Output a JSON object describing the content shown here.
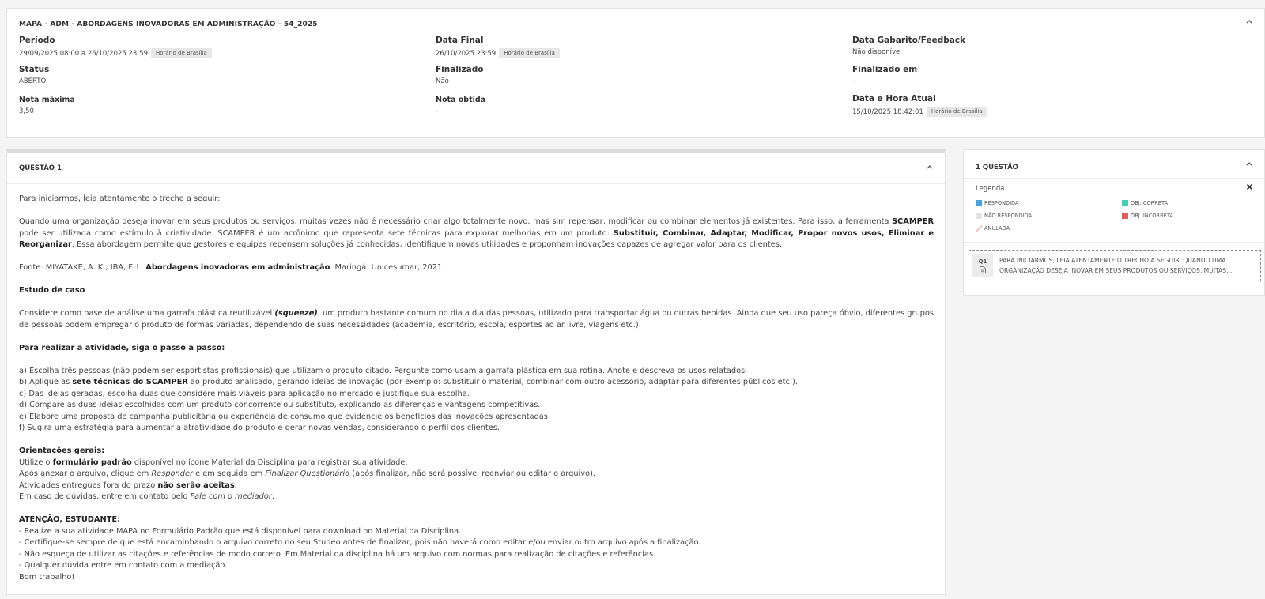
{
  "header": {
    "title": "MAPA - ADM - ABORDAGENS INOVADORAS EM ADMINISTRAÇÃO - 54_2025",
    "fields": {
      "periodo_label": "Período",
      "periodo_value": "29/09/2025 08:00 a 26/10/2025 23:59",
      "periodo_badge": "Horário de Brasília",
      "data_final_label": "Data Final",
      "data_final_value": "26/10/2025 23:59",
      "data_final_badge": "Horário de Brasília",
      "gabarito_label": "Data Gabarito/Feedback",
      "gabarito_value": "Não disponível",
      "status_label": "Status",
      "status_value": "ABERTO",
      "finalizado_label": "Finalizado",
      "finalizado_value": "Não",
      "finalizado_em_label": "Finalizado em",
      "finalizado_em_value": "-",
      "nota_maxima_label": "Nota máxima",
      "nota_maxima_value": "3,50",
      "nota_obtida_label": "Nota obtida",
      "nota_obtida_value": "-",
      "data_hora_label": "Data e Hora Atual",
      "data_hora_value": "15/10/2025 18:42:01",
      "data_hora_badge": "Horário de Brasília"
    }
  },
  "question": {
    "header": "QUESTÃO 1",
    "intro": "Para iniciarmos, leia atentamente o trecho a seguir:",
    "p1_a": "Quando uma organização deseja inovar em seus produtos ou serviços, muitas vezes não é necessário criar algo totalmente novo, mas sim repensar, modificar ou combinar elementos já existentes. Para isso, a ferramenta ",
    "p1_b": "SCAMPER",
    "p1_c": " pode ser utilizada como estímulo à criatividade. SCAMPER é um acrônimo que representa sete técnicas para explorar melhorias em um produto: ",
    "p1_d": "Substituir, Combinar, Adaptar, Modificar, Propor novos usos, Eliminar e Reorganizar",
    "p1_e": ". Essa abordagem permite que gestores e equipes repensem soluções já conhecidas, identifiquem novas utilidades e proponham inovações capazes de agregar valor para os clientes.",
    "fonte_a": "Fonte: MIYATAKE, A. K.; IBA, F. L. ",
    "fonte_b": "Abordagens inovadoras em administração",
    "fonte_c": ". Maringá: Unicesumar, 2021.",
    "estudo_title": "Estudo de caso",
    "estudo_a": "Considere como base de análise uma garrafa plástica reutilizável ",
    "estudo_b": "(squeeze)",
    "estudo_c": ", um produto bastante comum no dia a dia das pessoas, utilizado para transportar água ou outras bebidas. Ainda que seu uso pareça óbvio, diferentes grupos de pessoas podem empregar o produto de formas variadas, dependendo de suas necessidades (academia, escritório, escola, esportes ao ar livre, viagens etc.).",
    "passo_title": "Para realizar a atividade, siga o passo a passo:",
    "step_a": "a) Escolha três pessoas (não podem ser esportistas profissionais) que utilizam o produto citado. Pergunte como usam a garrafa plástica em sua rotina. Anote e descreva os usos relatados.",
    "step_b_1": "b) Aplique as ",
    "step_b_2": "sete técnicas do SCAMPER",
    "step_b_3": " ao produto analisado, gerando ideias de inovação (por exemplo: substituir o material, combinar com outro acessório, adaptar para diferentes públicos etc.).",
    "step_c": "c) Das ideias geradas, escolha duas que considere mais viáveis para aplicação no mercado e justifique sua escolha.",
    "step_d": "d) Compare as duas ideias escolhidas com um produto concorrente ou substituto, explicando as diferenças e vantagens competitivas.",
    "step_e": "e) Elabore uma proposta de campanha publicitária ou experiência de consumo que evidencie os benefícios das inovações apresentadas.",
    "step_f": "f) Sugira uma estratégia para aumentar a atratividade do produto e gerar novas vendas, considerando o perfil dos clientes.",
    "orient_title": "Orientações gerais:",
    "orient_1a": "Utilize o ",
    "orient_1b": "formulário padrão",
    "orient_1c": " disponível no ícone Material da Disciplina para registrar sua atividade.",
    "orient_2a": "Após anexar o arquivo, clique em ",
    "orient_2b": "Responder",
    "orient_2c": " e em seguida em ",
    "orient_2d": "Finalizar Questionário",
    "orient_2e": " (após finalizar, não será possível reenviar ou editar o arquivo).",
    "orient_3a": "Atividades entregues fora do prazo ",
    "orient_3b": "não serão aceitas",
    "orient_3c": ".",
    "orient_4a": "Em caso de dúvidas, entre em contato pelo ",
    "orient_4b": "Fale com o mediador",
    "orient_4c": ".",
    "atencao_title": "ATENÇÃO, ESTUDANTE:",
    "atencao_1": "- Realize a sua atividade MAPA no Formulário Padrão que está disponível para download no Material da Disciplina.",
    "atencao_2": "- Certifique-se sempre de que está encaminhando o arquivo correto no seu Studeo antes de finalizar, pois não haverá como editar e/ou enviar outro arquivo após a finalização.",
    "atencao_3": "- Não esqueça de utilizar as citações e referências de modo correto. Em Material da disciplina há um arquivo com normas para realização de citações e referências.",
    "atencao_4": "- Qualquer dúvida entre em contato com a mediação.",
    "closing": "Bom trabalho!"
  },
  "side": {
    "title": "1 QUESTÃO",
    "legend_title": "Legenda",
    "legend": {
      "respondida": "RESPONDIDA",
      "obj_correta": "OBJ. CORRETA",
      "nao_respondida": "NÃO RESPONDIDA",
      "obj_incorreta": "OBJ. INCORRETA",
      "anulada": "ANULADA"
    },
    "item_number": "Q1",
    "item_text": "PARA INICIARMOS, LEIA ATENTAMENTE O TRECHO A SEGUIR: QUANDO UMA ORGANIZAÇÃO DESEJA INOVAR EM SEUS PRODUTOS OU SERVIÇOS, MUITAS..."
  },
  "colors": {
    "respondida": "#4aa3df",
    "obj_correta": "#3fd1b0",
    "nao_respondida": "#e3e3e3",
    "obj_incorreta": "#ec5b5b",
    "anulada": "#f3b8b8"
  },
  "icons": {
    "collapse": "chevron-up-icon",
    "close": "close-icon",
    "document": "document-icon"
  }
}
